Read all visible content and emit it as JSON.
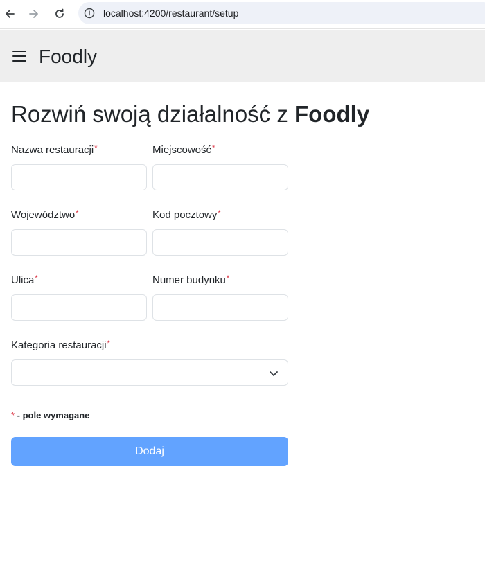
{
  "browser": {
    "url": "localhost:4200/restaurant/setup",
    "icons": [
      "back-arrow-icon",
      "forward-arrow-icon",
      "reload-icon",
      "info-icon"
    ]
  },
  "header": {
    "brand": "Foodly",
    "menu_icon": "hamburger-menu-icon"
  },
  "page": {
    "title_prefix": "Rozwiń swoją działalność z ",
    "title_brand": "Foodly"
  },
  "form": {
    "fields": [
      {
        "label": "Nazwa restauracji",
        "value": "",
        "required_mark": "*"
      },
      {
        "label": "Miejscowość",
        "value": "",
        "required_mark": "*"
      },
      {
        "label": "Województwo",
        "value": "",
        "required_mark": "*"
      },
      {
        "label": "Kod pocztowy",
        "value": "",
        "required_mark": "*"
      },
      {
        "label": "Ulica",
        "value": "",
        "required_mark": "*"
      },
      {
        "label": "Numer budynku",
        "value": "",
        "required_mark": "*"
      }
    ],
    "category": {
      "label": "Kategoria restauracji",
      "value": "",
      "required_mark": "*",
      "icon": "chevron-down-icon"
    },
    "required_note_star": "*",
    "required_note_text": " - pole wymagane",
    "submit_label": "Dodaj"
  },
  "colors": {
    "required": "#dc3545",
    "submit_button": "#62a3ff",
    "header_bg": "#eeeeee",
    "address_bar_bg": "#eef1f8"
  }
}
